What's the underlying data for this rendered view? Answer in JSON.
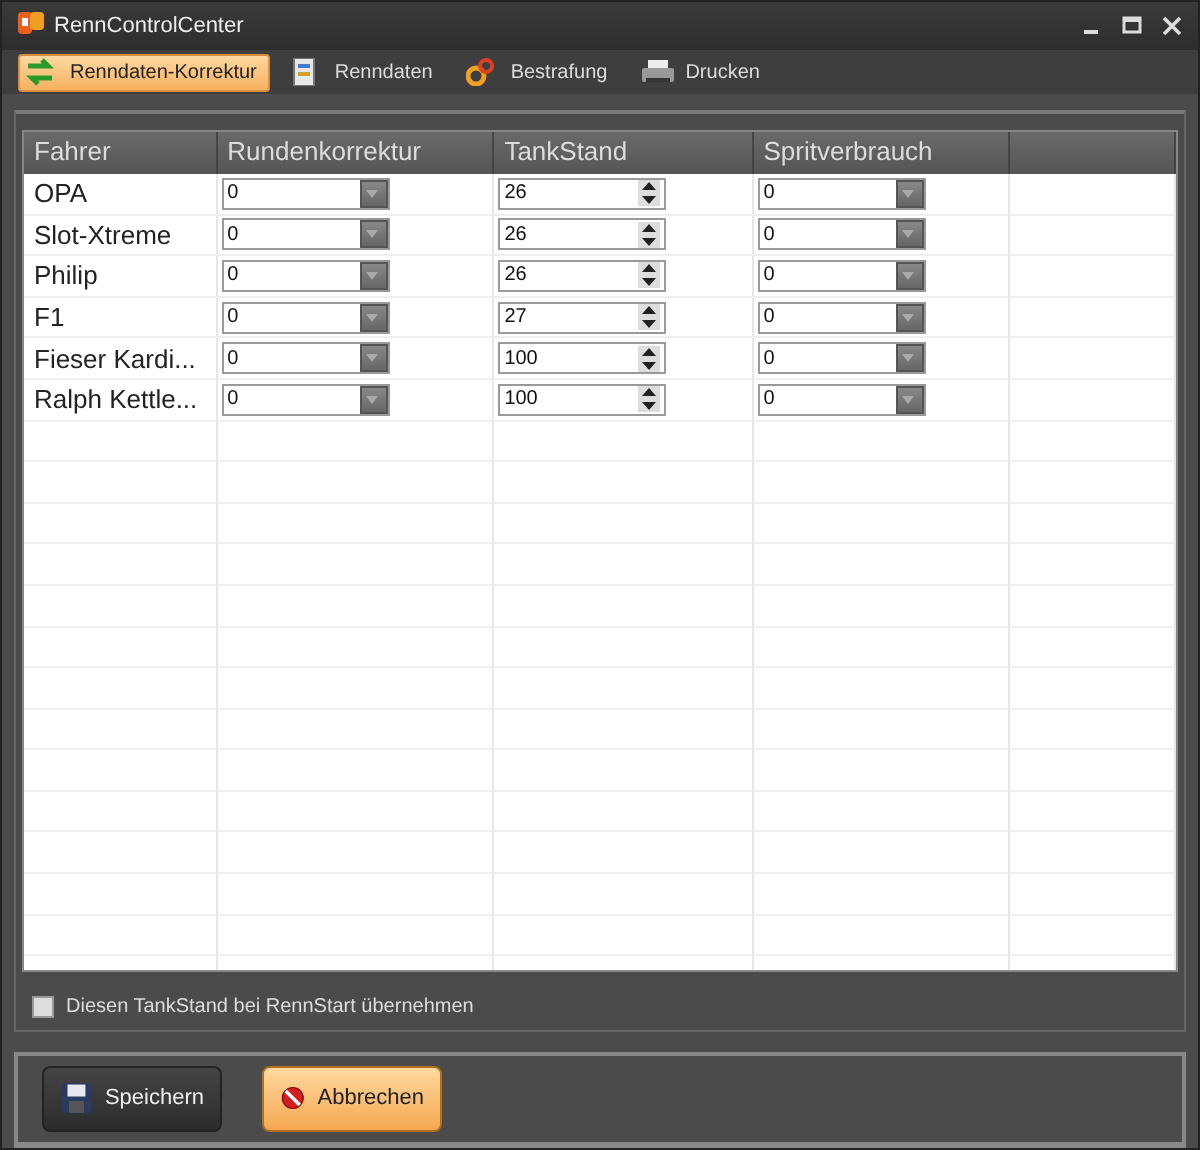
{
  "window": {
    "title": "RennControlCenter"
  },
  "tabs": [
    {
      "label": "Renndaten-Korrektur",
      "kind": "swap",
      "selected": true
    },
    {
      "label": "Renndaten",
      "kind": "sheet",
      "selected": false
    },
    {
      "label": "Bestrafung",
      "kind": "gears",
      "selected": false
    },
    {
      "label": "Drucken",
      "kind": "printer",
      "selected": false
    }
  ],
  "table": {
    "columns": [
      "Fahrer",
      "Rundenkorrektur",
      "TankStand",
      "Spritverbrauch"
    ],
    "rows": [
      {
        "fahrer": "OPA",
        "rundenkorrektur": "0",
        "tankstand": "26",
        "spritverbrauch": "0"
      },
      {
        "fahrer": "Slot-Xtreme",
        "rundenkorrektur": "0",
        "tankstand": "26",
        "spritverbrauch": "0"
      },
      {
        "fahrer": "Philip",
        "rundenkorrektur": "0",
        "tankstand": "26",
        "spritverbrauch": "0"
      },
      {
        "fahrer": "F1",
        "rundenkorrektur": "0",
        "tankstand": "27",
        "spritverbrauch": "0"
      },
      {
        "fahrer": "Fieser Kardi...",
        "rundenkorrektur": "0",
        "tankstand": "100",
        "spritverbrauch": "0"
      },
      {
        "fahrer": "Ralph Kettle...",
        "rundenkorrektur": "0",
        "tankstand": "100",
        "spritverbrauch": "0"
      }
    ]
  },
  "checkbox": {
    "label": "Diesen TankStand bei RennStart übernehmen",
    "checked": false
  },
  "buttons": [
    {
      "label": "Speichern",
      "kind": "save",
      "selected": false
    },
    {
      "label": "Abbrechen",
      "kind": "cancel",
      "selected": true
    }
  ]
}
